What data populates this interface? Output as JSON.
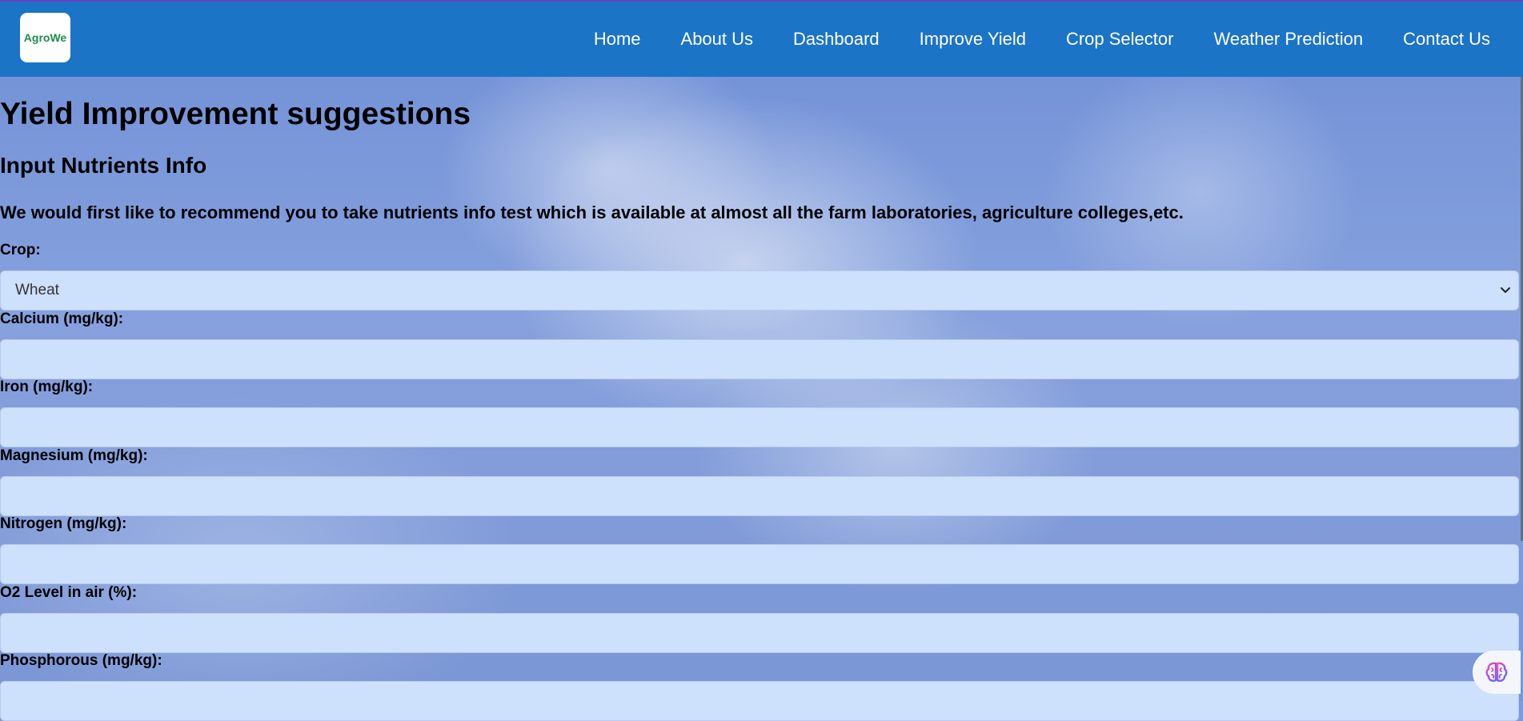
{
  "brand": {
    "logo_text": "AgroWe"
  },
  "nav": {
    "links": [
      "Home",
      "About Us",
      "Dashboard",
      "Improve Yield",
      "Crop Selector",
      "Weather Prediction",
      "Contact Us"
    ]
  },
  "page": {
    "title": "Yield Improvement suggestions",
    "section_title": "Input Nutrients Info",
    "recommendation": "We would first like to recommend you to take nutrients info test which is available at almost all the farm laboratories, agriculture colleges,etc."
  },
  "form": {
    "crop": {
      "label": "Crop:",
      "selected": "Wheat"
    },
    "calcium": {
      "label": "Calcium (mg/kg):",
      "value": ""
    },
    "iron": {
      "label": "Iron (mg/kg):",
      "value": ""
    },
    "magnesium": {
      "label": "Magnesium (mg/kg):",
      "value": ""
    },
    "nitrogen": {
      "label": "Nitrogen (mg/kg):",
      "value": ""
    },
    "o2": {
      "label": "O2 Level in air (%):",
      "value": ""
    },
    "phosphorous": {
      "label": "Phosphorous (mg/kg):",
      "value": ""
    }
  },
  "colors": {
    "navbar": "#1c74c6",
    "field_bg": "#cde0fc",
    "accent_line": "#6a3fc1"
  },
  "icons": {
    "select": "chevron-down-icon",
    "assistant": "brain-icon"
  }
}
